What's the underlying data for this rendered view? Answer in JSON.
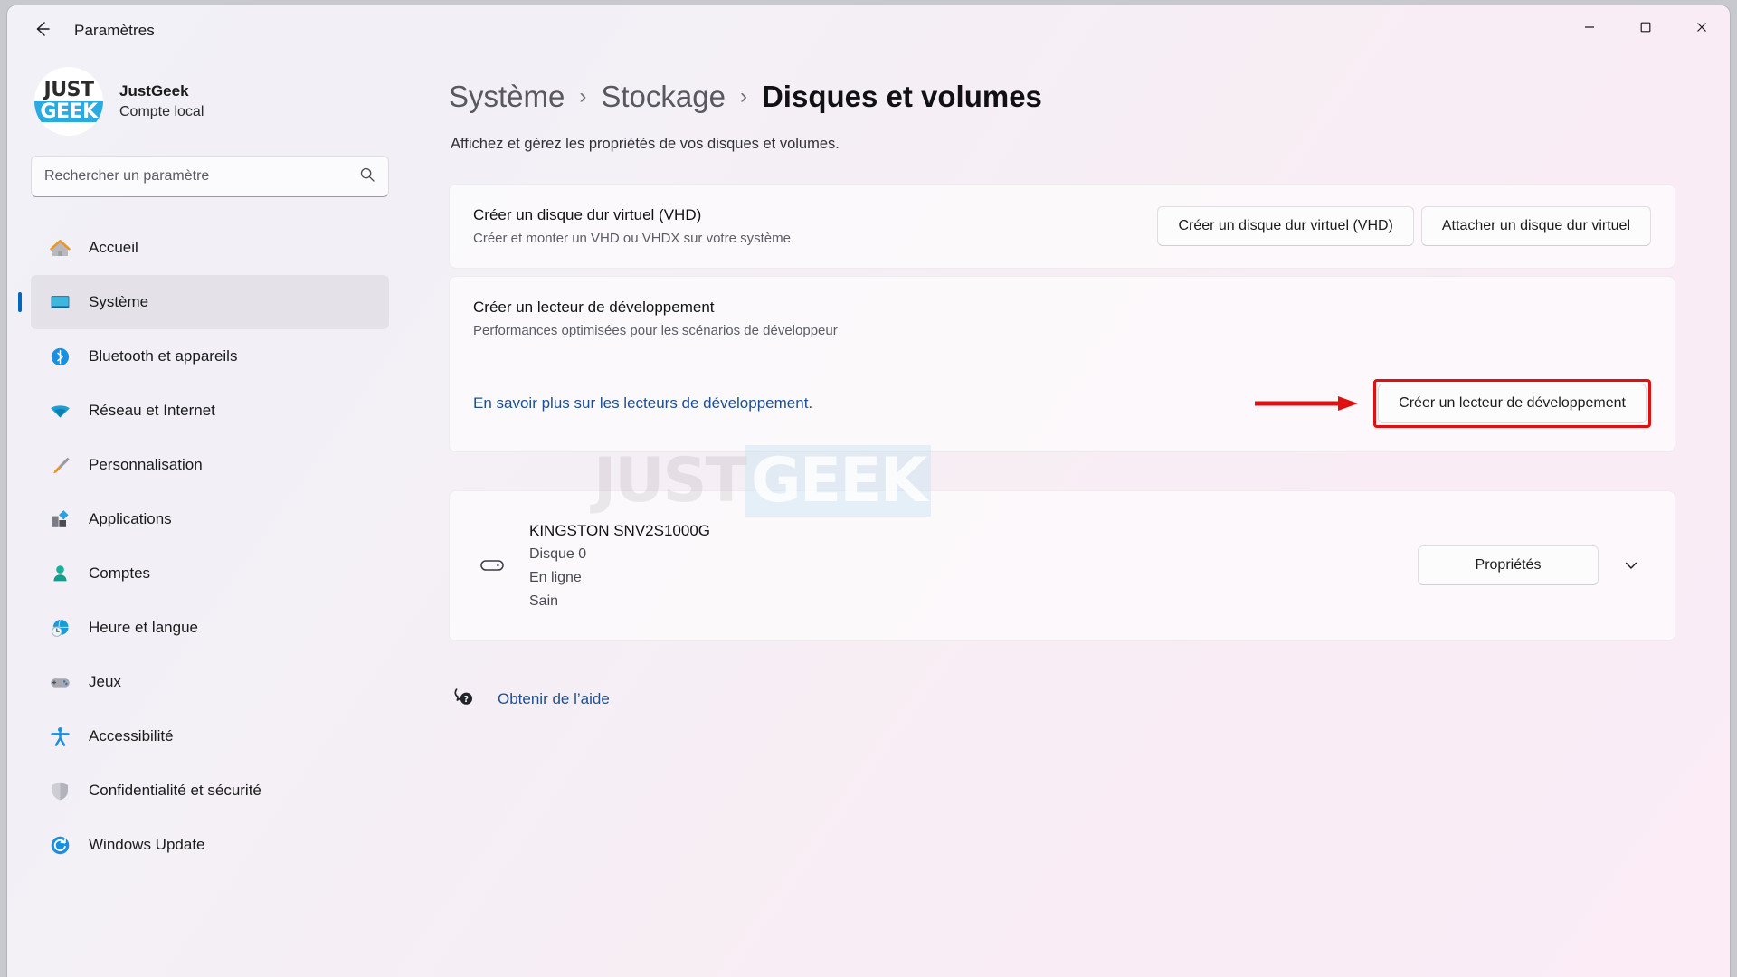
{
  "window": {
    "title": "Paramètres",
    "back_icon": "back-arrow-icon",
    "minimize_label": "—",
    "maximize_label": "□",
    "close_label": "✕"
  },
  "sidebar": {
    "account": {
      "logo_primary": "JUST",
      "logo_secondary": "GEEK",
      "name": "JustGeek",
      "subtitle": "Compte local"
    },
    "search": {
      "placeholder": "Rechercher un paramètre",
      "value": "",
      "icon": "search-icon"
    },
    "items": [
      {
        "label": "Accueil",
        "icon": "home-icon",
        "active": false
      },
      {
        "label": "Système",
        "icon": "display-icon",
        "active": true
      },
      {
        "label": "Bluetooth et appareils",
        "icon": "bluetooth-icon",
        "active": false
      },
      {
        "label": "Réseau et Internet",
        "icon": "wifi-icon",
        "active": false
      },
      {
        "label": "Personnalisation",
        "icon": "paintbrush-icon",
        "active": false
      },
      {
        "label": "Applications",
        "icon": "apps-icon",
        "active": false
      },
      {
        "label": "Comptes",
        "icon": "person-icon",
        "active": false
      },
      {
        "label": "Heure et langue",
        "icon": "clock-globe-icon",
        "active": false
      },
      {
        "label": "Jeux",
        "icon": "gamepad-icon",
        "active": false
      },
      {
        "label": "Accessibilité",
        "icon": "accessibility-icon",
        "active": false
      },
      {
        "label": "Confidentialité et sécurité",
        "icon": "shield-icon",
        "active": false
      },
      {
        "label": "Windows Update",
        "icon": "update-icon",
        "active": false
      }
    ]
  },
  "main": {
    "breadcrumb": {
      "parent1": "Système",
      "separator": "›",
      "parent2": "Stockage",
      "current": "Disques et volumes"
    },
    "page_subtitle": "Affichez et gérez les propriétés de vos disques et volumes.",
    "vhd_card": {
      "title": "Créer un disque dur virtuel (VHD)",
      "description": "Créer et monter un VHD ou VHDX sur votre système",
      "button_create": "Créer un disque dur virtuel (VHD)",
      "button_attach": "Attacher un disque dur virtuel"
    },
    "dev_card": {
      "title": "Créer un lecteur de développement",
      "description": "Performances optimisées pour les scénarios de développeur",
      "learn_more": "En savoir plus sur les lecteurs de développement.",
      "button_create": "Créer un lecteur de développement",
      "highlight_color": "#e01010",
      "annotation_icon": "red-arrow-icon"
    },
    "disk_card": {
      "icon": "disk-drive-icon",
      "name": "KINGSTON SNV2S1000G",
      "disk_number": "Disque 0",
      "status": "En ligne",
      "health": "Sain",
      "button_properties": "Propriétés",
      "expand_icon": "chevron-down-icon"
    },
    "help": {
      "icon": "help-bubble-icon",
      "label": "Obtenir de l’aide"
    }
  },
  "watermark": {
    "part1": "JUST",
    "part2": "GEEK"
  }
}
